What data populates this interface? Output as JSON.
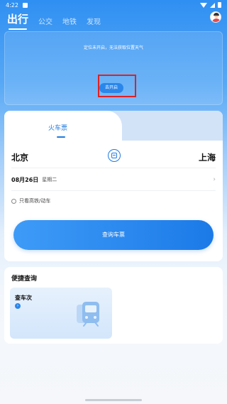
{
  "status_bar": {
    "time": "4:22"
  },
  "top_nav": {
    "tabs": [
      {
        "label": "出行",
        "active": true
      },
      {
        "label": "公交",
        "active": false
      },
      {
        "label": "地铁",
        "active": false
      },
      {
        "label": "发现",
        "active": false
      }
    ]
  },
  "weather": {
    "message": "定位未开启，无法获取位置天气",
    "open_button_label": "去开启"
  },
  "ticket": {
    "tab_label": "火车票",
    "from_city": "北京",
    "to_city": "上海",
    "date": "08月26日",
    "weekday": "星期二",
    "filter_label": "只看高铁/动车",
    "query_button_label": "查询车票"
  },
  "quick": {
    "title": "便捷查询",
    "items": [
      {
        "label": "查车次",
        "icon": "arrow-right-icon"
      }
    ]
  },
  "colors": {
    "accent": "#1f7ae0",
    "highlight": "#e02020"
  }
}
